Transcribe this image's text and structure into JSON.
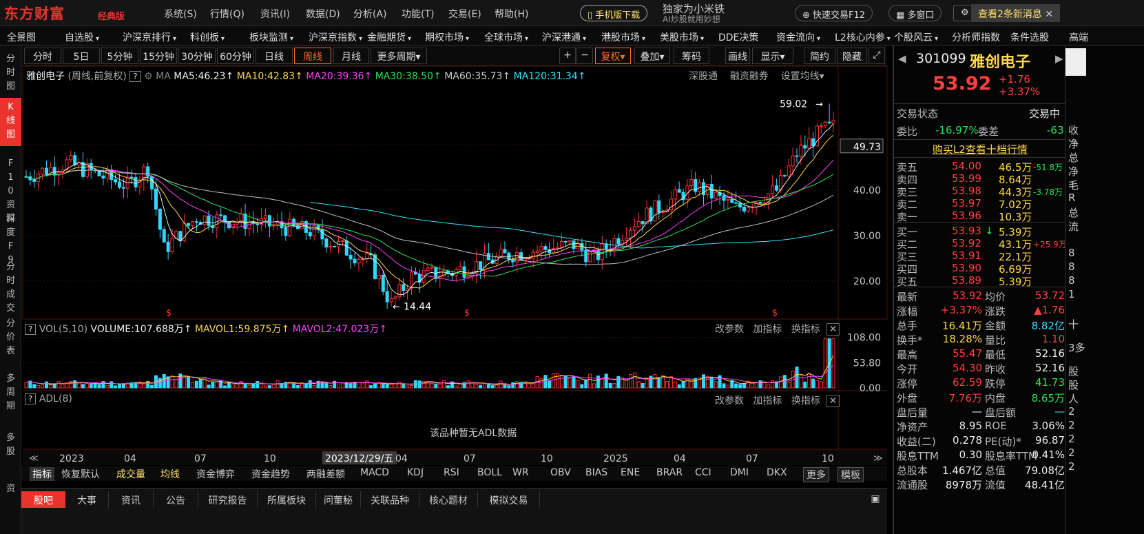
{
  "app": {
    "logo": "东方财富",
    "edition": "经典版",
    "banner": "独家为小米铁",
    "banner_sub": "AI炒股就用妙想"
  },
  "top_menu": [
    "系统(S)",
    "行情(Q)",
    "资讯(I)",
    "数据(D)",
    "分析(A)",
    "功能(T)",
    "交易(E)",
    "帮助(H)"
  ],
  "top_buttons": {
    "mobile": "手机版下载",
    "quick_trade": "快速交易F12",
    "multi_window": "多窗口",
    "news": "查看2条新消息"
  },
  "nav": [
    "全景图",
    "自选股",
    "沪深京排行",
    "科创板",
    "板块监测",
    "沪深京指数",
    "金融期货",
    "期权市场",
    "全球市场",
    "沪深港通",
    "港股市场",
    "美股市场",
    "DDE决策",
    "资金流向",
    "L2核心内参",
    "个股风云",
    "分析师指数",
    "条件选股",
    "高端"
  ],
  "left_tabs": [
    "分时图",
    "K线图",
    "F10资料",
    "深度F9",
    "分时成交",
    "分价表",
    "多周期",
    "多股",
    "资"
  ],
  "periods": [
    "分时",
    "5日",
    "5分钟",
    "15分钟",
    "30分钟",
    "60分钟",
    "日线",
    "周线",
    "月线",
    "更多周期"
  ],
  "period_active": "周线",
  "period_right": [
    "+",
    "−",
    "复权",
    "叠加",
    "筹码",
    "画线",
    "显示",
    "简约",
    "隐藏"
  ],
  "ma": {
    "name": "雅创电子",
    "mode": "(周线,前复权)",
    "ma": "MA",
    "ma5": "MA5:46.23",
    "ma10": "MA10:42.83",
    "ma20": "MA20:39.36",
    "ma30": "MA30:38.50",
    "ma60": "MA60:35.73",
    "ma120": "MA120:31.34",
    "links": [
      "深股通",
      "融资融券",
      "设置均线"
    ]
  },
  "price_axis": [
    "50.00",
    "40.00",
    "30.00",
    "20.00"
  ],
  "price_current": "49.73",
  "high_label": "59.02",
  "low_label": "14.44",
  "time_labels": [
    "2023",
    "04",
    "07",
    "10",
    "2023/12/29/五",
    "04",
    "07",
    "10",
    "2025",
    "04",
    "07",
    "10"
  ],
  "volume": {
    "title": "VOL(5,10)",
    "vol": "VOLUME:107.688万",
    "mavol1": "MAVOL1:59.875万",
    "mavol2": "MAVOL2:47.023万",
    "axis": [
      "108.00",
      "53.80",
      "0.00"
    ]
  },
  "adl": {
    "title": "ADL(8)",
    "empty": "该品种暂无ADL数据"
  },
  "panel_actions": [
    "改参数",
    "加指标",
    "换指标"
  ],
  "indicators": [
    "指标",
    "恢复默认",
    "成交量",
    "均线",
    "资金博弈",
    "资金趋势",
    "两融差额",
    "MACD",
    "KDJ",
    "RSI",
    "BOLL",
    "WR",
    "OBV",
    "BIAS",
    "ENE",
    "BRAR",
    "CCI",
    "DMI",
    "DKX",
    "更多",
    "模板"
  ],
  "bottom_tabs": [
    "股吧",
    "大事",
    "资讯",
    "公告",
    "研究报告",
    "所属板块",
    "问董秘",
    "关联品种",
    "核心题材",
    "模拟交易"
  ],
  "stock": {
    "code": "301099",
    "name": "雅创电子",
    "price": "53.92",
    "change": "+1.76",
    "pct": "+3.37%",
    "status_label": "交易状态",
    "status": "交易中",
    "webi_label": "委比",
    "webi": "-16.97%",
    "weicha_label": "委差",
    "weicha": "-63",
    "l2_link": "购买L2查看十档行情",
    "asks": [
      {
        "label": "卖五",
        "price": "54.00",
        "vol": "46.5万",
        "chg": "-51.8万"
      },
      {
        "label": "卖四",
        "price": "53.99",
        "vol": "8.64万",
        "chg": ""
      },
      {
        "label": "卖三",
        "price": "53.98",
        "vol": "44.3万",
        "chg": "-3.78万"
      },
      {
        "label": "卖二",
        "price": "53.97",
        "vol": "7.02万",
        "chg": ""
      },
      {
        "label": "卖一",
        "price": "53.96",
        "vol": "10.3万",
        "chg": ""
      }
    ],
    "bids": [
      {
        "label": "买一",
        "price": "53.93",
        "vol": "5.39万",
        "chg": ""
      },
      {
        "label": "买二",
        "price": "53.92",
        "vol": "43.1万",
        "chg": "+25.9万"
      },
      {
        "label": "买三",
        "price": "53.91",
        "vol": "22.1万",
        "chg": ""
      },
      {
        "label": "买四",
        "price": "53.90",
        "vol": "6.69万",
        "chg": ""
      },
      {
        "label": "买五",
        "price": "53.89",
        "vol": "5.39万",
        "chg": ""
      }
    ],
    "stats": [
      [
        "最新",
        "53.92",
        "均价",
        "53.72"
      ],
      [
        "涨幅",
        "+3.37%",
        "涨跌",
        "▲1.76"
      ],
      [
        "总手",
        "16.41万",
        "金额",
        "8.82亿"
      ],
      [
        "换手*",
        "18.28%",
        "量比",
        "1.10"
      ],
      [
        "最高",
        "55.47",
        "最低",
        "52.16"
      ],
      [
        "今开",
        "54.30",
        "昨收",
        "52.16"
      ],
      [
        "涨停",
        "62.59",
        "跌停",
        "41.73"
      ],
      [
        "外盘",
        "7.76万",
        "内盘",
        "8.65万"
      ],
      [
        "盘后量",
        "—",
        "盘后额",
        "—"
      ],
      [
        "净资产",
        "8.95",
        "ROE",
        "3.06%"
      ],
      [
        "收益(二)",
        "0.278",
        "PE(动)*",
        "96.87"
      ],
      [
        "股息TTM",
        "0.30",
        "股息率TTM",
        "0.41%"
      ],
      [
        "总股本",
        "1.467亿",
        "总值",
        "79.08亿"
      ],
      [
        "流通股",
        "8978万",
        "流值",
        "48.41亿"
      ]
    ]
  },
  "far_right": [
    "收",
    "净",
    "总",
    "净",
    "毛",
    "R",
    "总",
    "流",
    "8",
    "8",
    "8",
    "1",
    "十",
    "3多",
    "股",
    "股",
    "人",
    "2",
    "2",
    "2",
    "2",
    "2"
  ]
}
